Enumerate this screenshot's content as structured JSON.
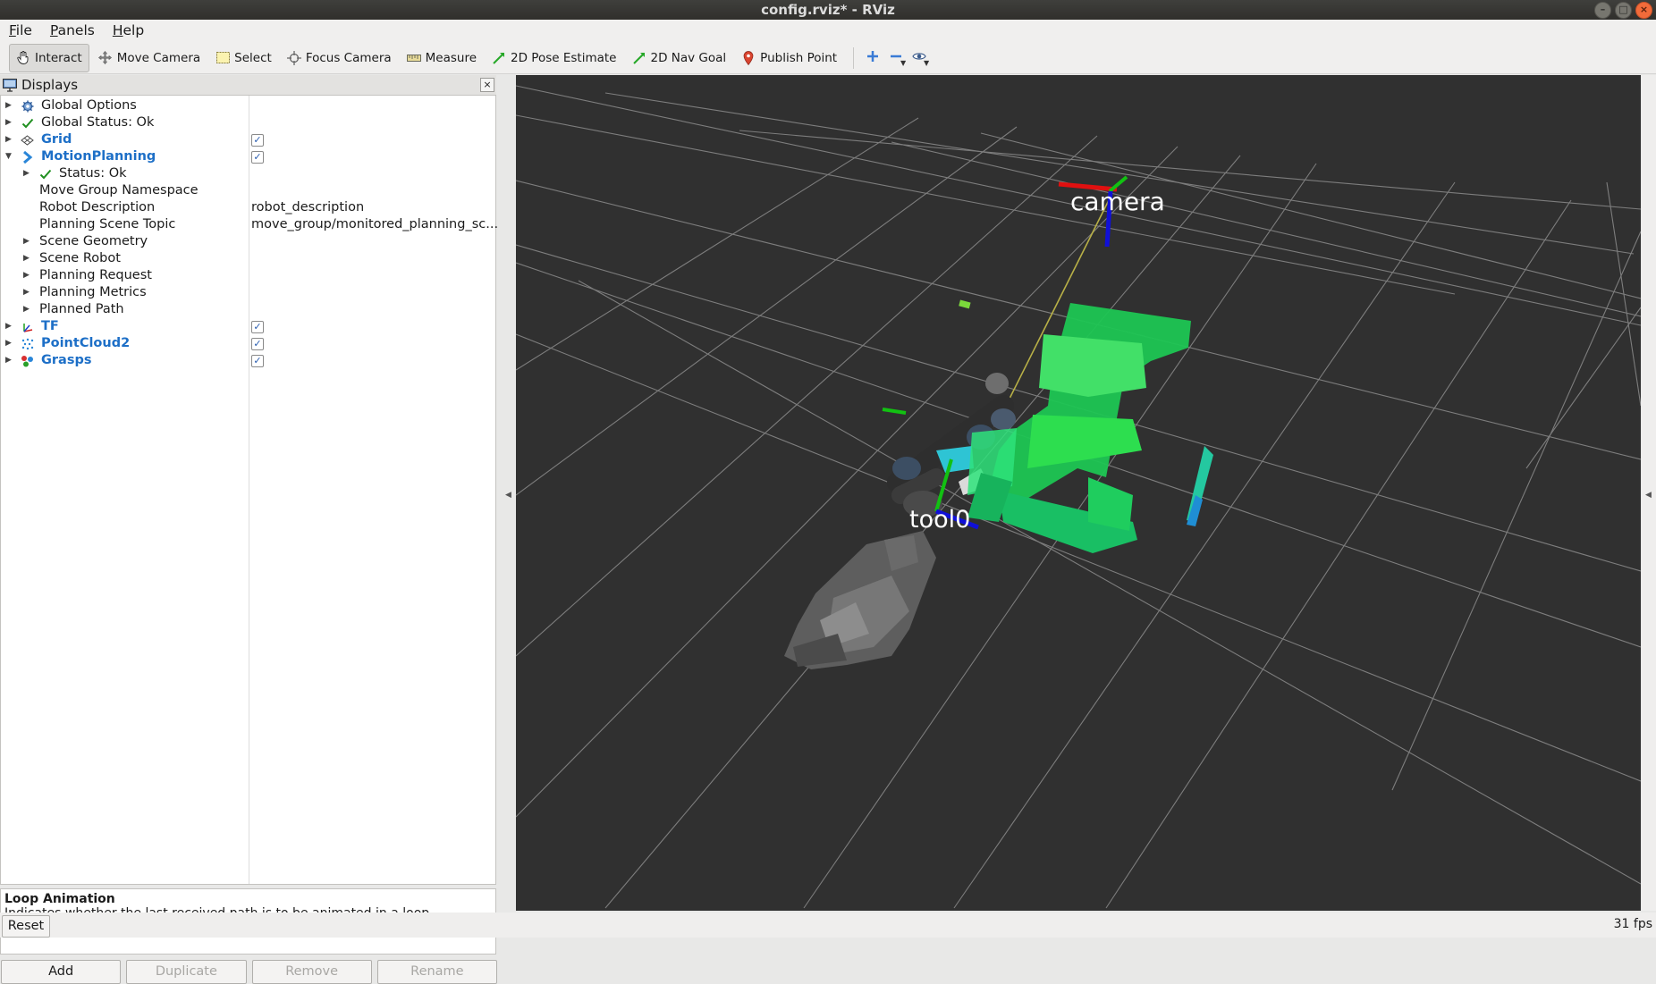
{
  "window": {
    "title": "config.rviz* - RViz"
  },
  "menu": [
    {
      "label": "File",
      "key": "F",
      "rest": "ile"
    },
    {
      "label": "Panels",
      "key": "P",
      "rest": "anels"
    },
    {
      "label": "Help",
      "key": "H",
      "rest": "elp"
    }
  ],
  "toolbar": {
    "interact": "Interact",
    "move_camera": "Move Camera",
    "select": "Select",
    "focus_camera": "Focus Camera",
    "measure": "Measure",
    "pose_estimate": "2D Pose Estimate",
    "nav_goal": "2D Nav Goal",
    "publish_point": "Publish Point"
  },
  "displays_panel": {
    "title": "Displays",
    "rows": {
      "global_options": "Global Options",
      "global_status": "Global Status: Ok",
      "grid": "Grid",
      "motion_planning": "MotionPlanning",
      "status": "Status: Ok",
      "move_group_namespace": "Move Group Namespace",
      "robot_description": "Robot Description",
      "robot_description_value": "robot_description",
      "planning_scene_topic": "Planning Scene Topic",
      "planning_scene_topic_value": "move_group/monitored_planning_sc...",
      "scene_geometry": "Scene Geometry",
      "scene_robot": "Scene Robot",
      "planning_request": "Planning Request",
      "planning_metrics": "Planning Metrics",
      "planned_path": "Planned Path",
      "tf": "TF",
      "pointcloud2": "PointCloud2",
      "grasps": "Grasps"
    },
    "checked": {
      "grid": true,
      "motion_planning": true,
      "tf": true,
      "pointcloud2": true,
      "grasps": true
    },
    "description": {
      "title": "Loop Animation",
      "text": "Indicates whether the last received path is to be animated in a loop"
    },
    "buttons": {
      "add": "Add",
      "duplicate": "Duplicate",
      "remove": "Remove",
      "rename": "Rename"
    }
  },
  "viewport": {
    "labels": {
      "camera": "camera",
      "tool": "tool0"
    },
    "background": "#303030"
  },
  "status": {
    "reset": "Reset",
    "fps": "31 fps"
  },
  "colors": {
    "accent_blue": "#1d6fc7",
    "axis_x": "#e01010",
    "axis_y": "#10c010",
    "axis_z": "#1010d8",
    "cloud_green": "#22d45a"
  }
}
